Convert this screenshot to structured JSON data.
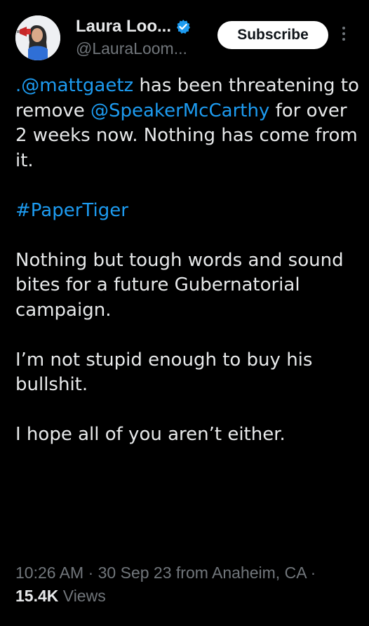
{
  "author": {
    "display_name": "Laura Loo...",
    "handle": "@LauraLoom...",
    "avatar_icon": "profile-photo-with-megaphone",
    "verified_icon": "verified-badge-icon",
    "verified_color": "#1d9bf0"
  },
  "actions": {
    "subscribe_label": "Subscribe",
    "more_icon": "vertical-ellipsis-icon"
  },
  "tweet": {
    "p1_mention1": ".@mattgaetz",
    "p1_text1": " has been threatening to remove ",
    "p1_mention2": "@SpeakerMcCarthy",
    "p1_text2": " for over 2 weeks now. Nothing has come from it.",
    "hashtag": "#PaperTiger",
    "p3": "Nothing but tough words and sound bites for a future Gubernatorial campaign.",
    "p4": "I’m not stupid enough to buy his bullshit.",
    "p5": "I hope all of you aren’t either."
  },
  "meta": {
    "time": "10:26 AM",
    "sep1": " · ",
    "date": "30 Sep 23",
    "location": " from Anaheim, CA",
    "sep2": " · ",
    "views_count": "15.4K",
    "views_label": " Views"
  },
  "colors": {
    "background": "#000000",
    "text": "#e7e9ea",
    "secondary": "#71767b",
    "link": "#1d9bf0"
  }
}
